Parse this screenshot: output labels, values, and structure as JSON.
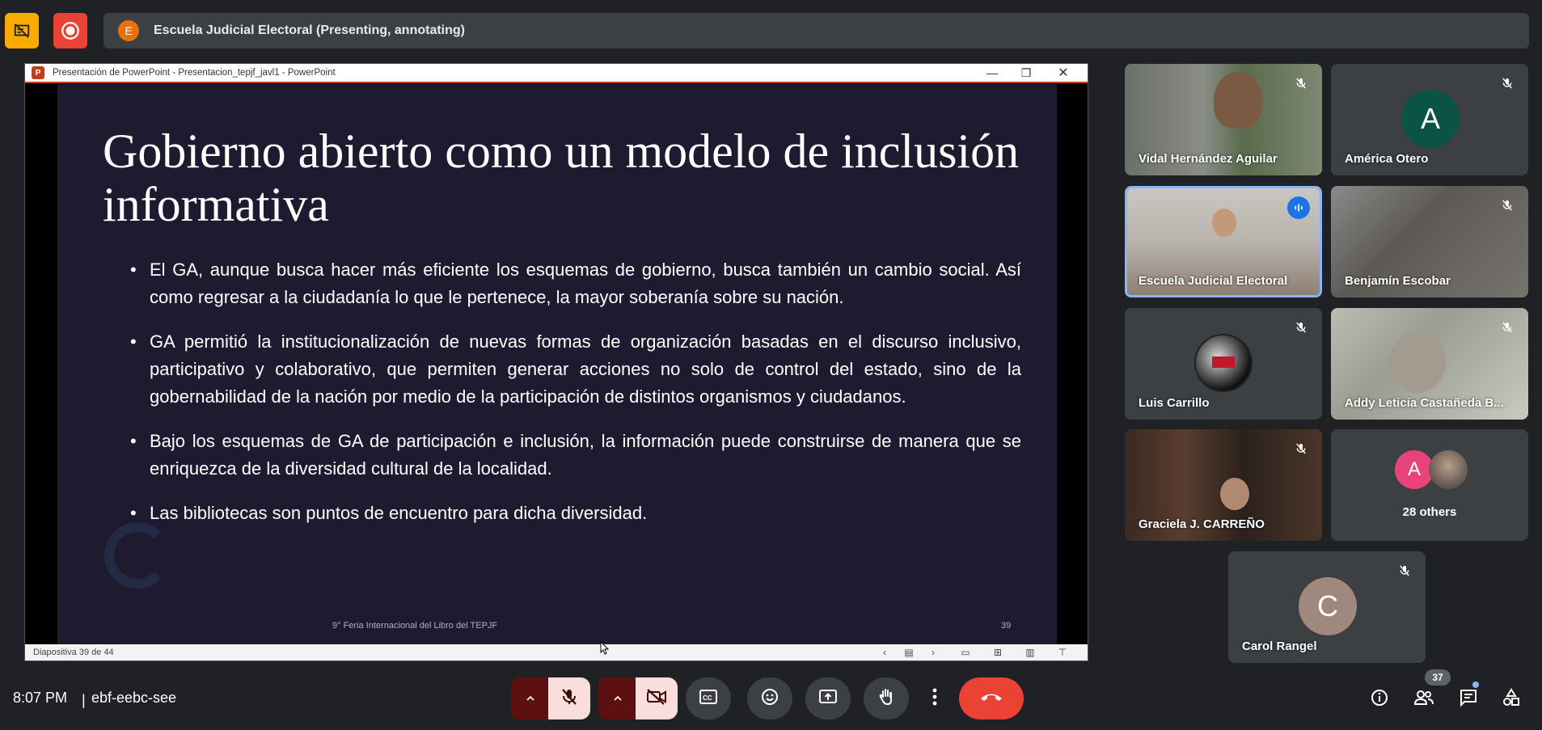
{
  "top": {
    "banner_initial": "E",
    "banner_title": "Escuela Judicial Electoral (Presenting, annotating)"
  },
  "ppt": {
    "window_title": "Presentación de PowerPoint  -  Presentacion_tepjf_javl1  -  PowerPoint",
    "status": "Diapositiva 39 de 44",
    "slide": {
      "title": "Gobierno abierto como un modelo de inclusión informativa",
      "bullets": [
        "El GA, aunque busca hacer más eficiente los esquemas de gobierno, busca también un cambio social. Así como regresar a la ciudadanía lo que le pertenece, la mayor soberanía sobre su nación.",
        "GA permitió la institucionalización de nuevas formas de organización basadas en el discurso inclusivo, participativo y colaborativo, que permiten generar acciones no solo de control del estado, sino de la gobernabilidad de la nación por medio de la participación de distintos organismos y ciudadanos.",
        "Bajo los esquemas de GA de participación e inclusión, la información puede construirse de manera que se enriquezca de la diversidad cultural de la localidad.",
        "Las bibliotecas son puntos de encuentro para dicha diversidad."
      ],
      "footer": "9° Feria Internacional del Libro del TEPJF",
      "number": "39"
    }
  },
  "participants": [
    {
      "name": "Vidal Hernández Aguilar"
    },
    {
      "name": "América Otero",
      "initial": "A",
      "color": "#0b5345"
    },
    {
      "name": "Escuela Judicial Electoral"
    },
    {
      "name": "Benjamín Escobar"
    },
    {
      "name": "Luis Carrillo"
    },
    {
      "name": "Addy Leticia Castañeda B..."
    },
    {
      "name": "Graciela J. CARREÑO"
    },
    {
      "name": "28 others",
      "initial": "A",
      "color": "#e8437a"
    },
    {
      "name": "Carol Rangel",
      "initial": "C",
      "color": "#a1887f"
    }
  ],
  "bottom": {
    "time": "8:07 PM",
    "separator": "|",
    "meeting_code": "ebf-eebc-see",
    "participant_count": "37"
  },
  "colors": {
    "background": "#202124",
    "tile": "#3c4043",
    "end_call": "#ea4335",
    "accent_blue": "#1a73e8"
  }
}
